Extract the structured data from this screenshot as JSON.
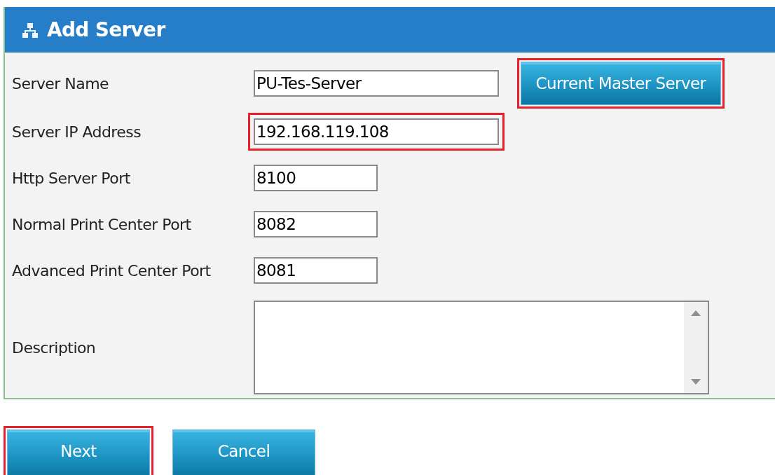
{
  "title": "Add Server",
  "fields": [
    {
      "label": "Server Name",
      "value": "PU-Tes-Server",
      "kind": "wide",
      "highlighted": false
    },
    {
      "label": "Server IP Address",
      "value": "192.168.119.108",
      "kind": "wide",
      "highlighted": true
    },
    {
      "label": "Http Server Port",
      "value": "8100",
      "kind": "short",
      "highlighted": false
    },
    {
      "label": "Normal Print Center Port",
      "value": "8082",
      "kind": "short",
      "highlighted": false
    },
    {
      "label": "Advanced Print Center Port",
      "value": "8081",
      "kind": "short",
      "highlighted": false
    },
    {
      "label": "Description",
      "kind": "textarea",
      "highlighted": false
    }
  ],
  "master_button": {
    "label": "Current Master Server",
    "highlighted": true
  },
  "buttons": [
    {
      "label": "Next",
      "highlighted": true
    },
    {
      "label": "Cancel",
      "highlighted": false
    }
  ]
}
